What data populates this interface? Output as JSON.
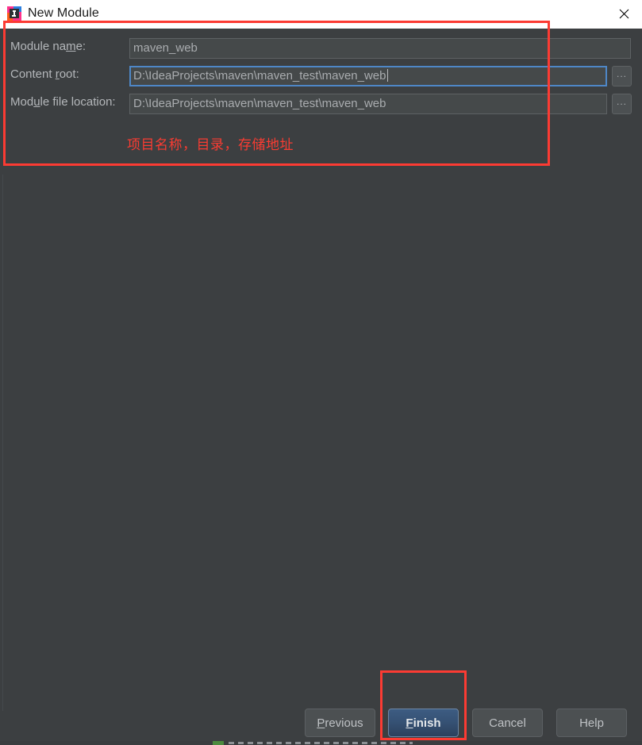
{
  "window": {
    "title": "New Module",
    "app_icon": "intellij-idea-icon",
    "close_icon": "close-icon"
  },
  "form": {
    "fields": [
      {
        "label_prefix": "Module na",
        "label_mnemonic": "m",
        "label_suffix": "e:",
        "value": "maven_web",
        "focused": false,
        "has_browse": false
      },
      {
        "label_prefix": "Content ",
        "label_mnemonic": "r",
        "label_suffix": "oot:",
        "value": "D:\\IdeaProjects\\maven\\maven_test\\maven_web",
        "focused": true,
        "has_browse": true,
        "browse_label": "..."
      },
      {
        "label_prefix": "Mod",
        "label_mnemonic": "u",
        "label_suffix": "le file location:",
        "value": "D:\\IdeaProjects\\maven\\maven_test\\maven_web",
        "focused": false,
        "has_browse": true,
        "browse_label": "..."
      }
    ]
  },
  "annotations": {
    "note_text": "项目名称，目录，存储地址",
    "note_color": "#fa3c32",
    "box_color": "#fc3b33"
  },
  "buttons": {
    "previous": {
      "prefix": "",
      "mnemonic": "P",
      "suffix": "revious"
    },
    "finish": {
      "prefix": "",
      "mnemonic": "F",
      "suffix": "inish"
    },
    "cancel": {
      "prefix": "Cancel",
      "mnemonic": "",
      "suffix": ""
    },
    "help": {
      "prefix": "Help",
      "mnemonic": "",
      "suffix": ""
    }
  },
  "theme": {
    "dialog_bg": "#3c3f41",
    "titlebar_bg": "#ffffff",
    "input_bg": "#45494a",
    "focus_border": "#4e87c7",
    "button_bg": "#4c5052",
    "primary_button_bg": "#365275",
    "label_color": "#b4b7ba"
  }
}
